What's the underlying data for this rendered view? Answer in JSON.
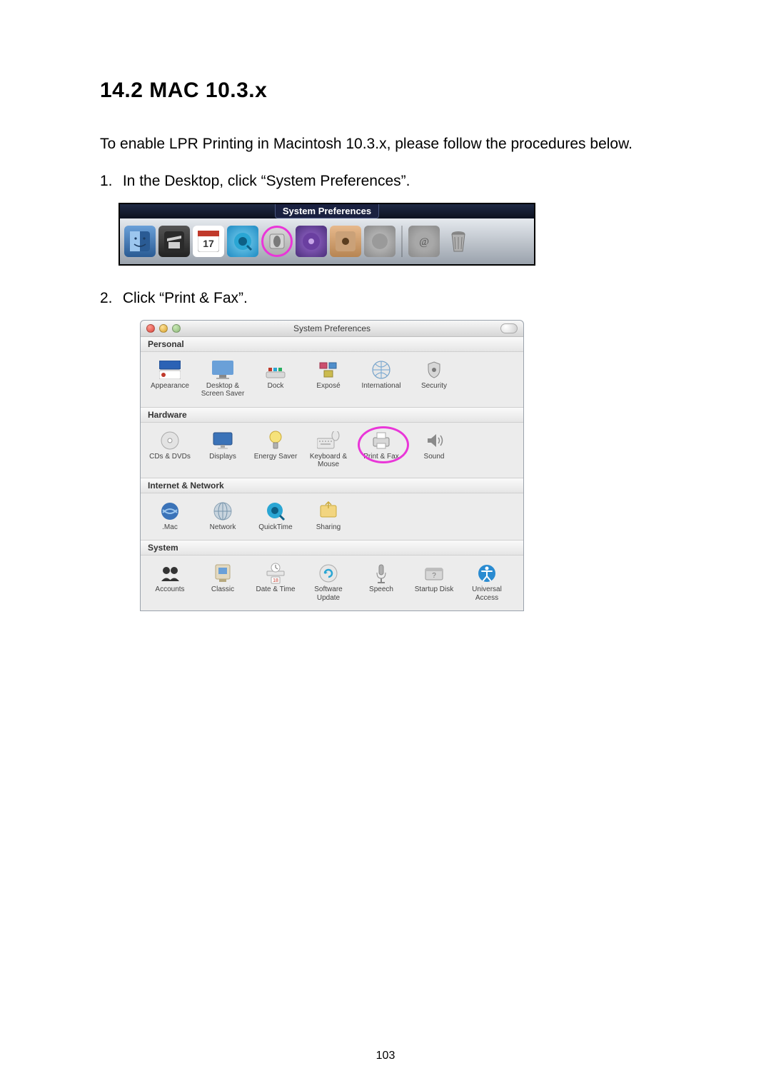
{
  "heading": "14.2  MAC 10.3.x",
  "intro": "To enable LPR Printing in Macintosh 10.3.x, please follow the procedures below.",
  "steps": [
    {
      "num": "1.",
      "text": "In the Desktop, click “System Preferences”."
    },
    {
      "num": "2.",
      "text": "Click “Print & Fax”."
    }
  ],
  "dock": {
    "tooltip": "System Preferences",
    "items": [
      {
        "name": "finder",
        "highlight": false
      },
      {
        "name": "imovie",
        "highlight": false
      },
      {
        "name": "ical",
        "day": "17",
        "highlight": false
      },
      {
        "name": "quicktime",
        "highlight": false
      },
      {
        "name": "system-preferences",
        "highlight": true
      },
      {
        "name": "itunes",
        "highlight": false
      },
      {
        "name": "iphoto",
        "highlight": false
      },
      {
        "name": "some-app",
        "highlight": false
      }
    ],
    "right_items": [
      {
        "name": "mail-at"
      },
      {
        "name": "trash"
      }
    ]
  },
  "syspref": {
    "title": "System Preferences",
    "sections": [
      {
        "header": "Personal",
        "items": [
          {
            "label": "Appearance",
            "icon": "appearance"
          },
          {
            "label": "Desktop & Screen Saver",
            "icon": "desktop"
          },
          {
            "label": "Dock",
            "icon": "dock"
          },
          {
            "label": "Exposé",
            "icon": "expose"
          },
          {
            "label": "International",
            "icon": "international"
          },
          {
            "label": "Security",
            "icon": "security"
          }
        ]
      },
      {
        "header": "Hardware",
        "items": [
          {
            "label": "CDs & DVDs",
            "icon": "cds"
          },
          {
            "label": "Displays",
            "icon": "displays"
          },
          {
            "label": "Energy Saver",
            "icon": "energy"
          },
          {
            "label": "Keyboard & Mouse",
            "icon": "keyboard"
          },
          {
            "label": "Print & Fax",
            "icon": "printfax",
            "highlight": true
          },
          {
            "label": "Sound",
            "icon": "sound"
          }
        ]
      },
      {
        "header": "Internet & Network",
        "items": [
          {
            "label": ".Mac",
            "icon": "dotmac"
          },
          {
            "label": "Network",
            "icon": "network"
          },
          {
            "label": "QuickTime",
            "icon": "quicktime"
          },
          {
            "label": "Sharing",
            "icon": "sharing"
          }
        ]
      },
      {
        "header": "System",
        "items": [
          {
            "label": "Accounts",
            "icon": "accounts"
          },
          {
            "label": "Classic",
            "icon": "classic"
          },
          {
            "label": "Date & Time",
            "icon": "datetime"
          },
          {
            "label": "Software Update",
            "icon": "update"
          },
          {
            "label": "Speech",
            "icon": "speech"
          },
          {
            "label": "Startup Disk",
            "icon": "startup"
          },
          {
            "label": "Universal Access",
            "icon": "universal"
          }
        ]
      }
    ]
  },
  "page_number": "103"
}
